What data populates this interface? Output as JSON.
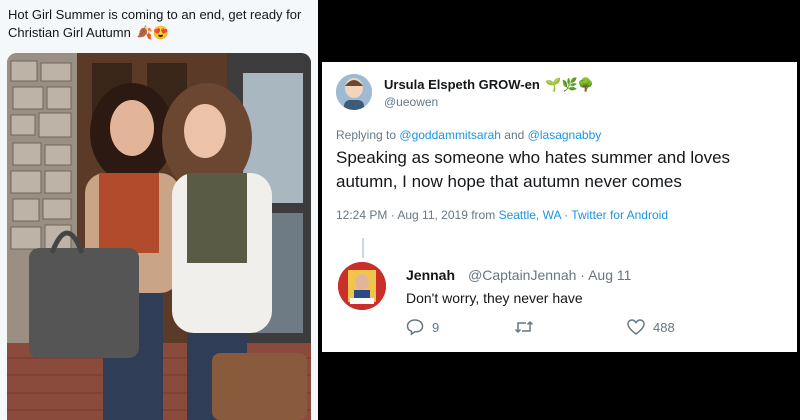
{
  "left_tweet": {
    "text": "Hot Girl Summer is coming to an end, get ready for Christian Girl Autumn",
    "emojis": "🍂😍"
  },
  "right_tweet": {
    "author_name": "Ursula Elspeth GROW-en",
    "author_emojis": "🌱🌿🌳",
    "author_handle": "@ueowen",
    "replying_to_label": "Replying to",
    "replying_to_user1": "@goddammitsarah",
    "replying_to_and": "and",
    "replying_to_user2": "@lasagnabby",
    "text": "Speaking as someone who hates summer and loves autumn, I now hope that autumn never comes",
    "timestamp": "12:24 PM · Aug 11, 2019 from",
    "location": "Seattle, WA",
    "separator": "·",
    "client": "Twitter for Android"
  },
  "reply": {
    "name": "Jennah",
    "handle": "@CaptainJennah · Aug 11",
    "text": "Don't worry, they never have",
    "reply_count": "9",
    "like_count": "488"
  },
  "colors": {
    "link": "#1b95e0",
    "muted": "#657786",
    "text": "#14171a"
  },
  "icons": [
    "reply-icon",
    "retweet-icon",
    "like-icon"
  ]
}
